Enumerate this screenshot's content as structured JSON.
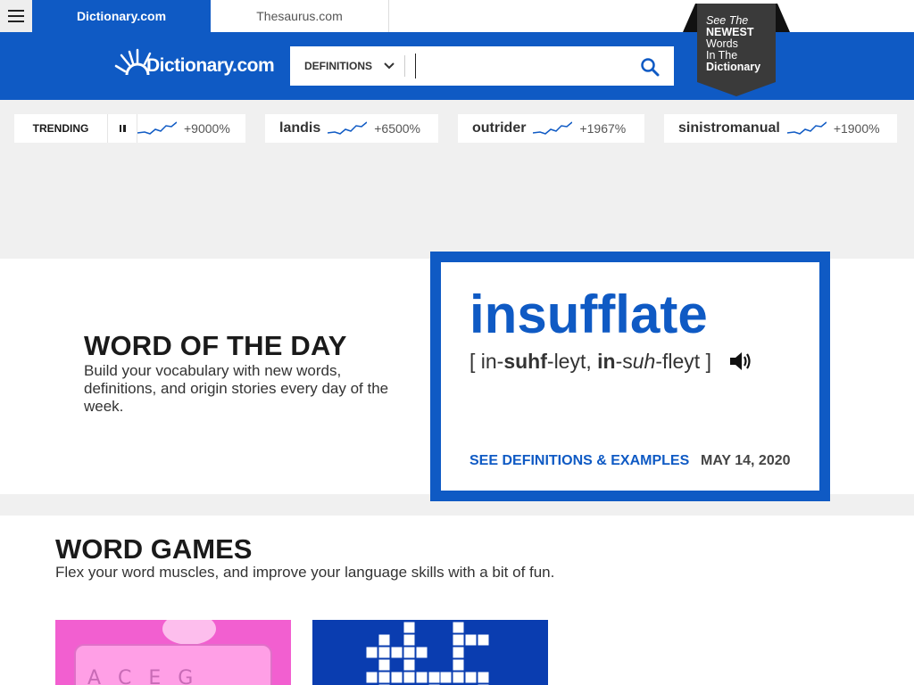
{
  "topbar": {
    "tab_dictionary": "Dictionary.com",
    "tab_thesaurus": "Thesaurus.com"
  },
  "header": {
    "logo_text": "Dictionary.com",
    "search": {
      "selector_label": "DEFINITIONS",
      "value": "",
      "placeholder": ""
    },
    "ribbon": {
      "line1": "See The",
      "line2": "NEWEST",
      "line3": "Words",
      "line4": "In The",
      "line5": "Dictionary"
    }
  },
  "trending": {
    "label": "TRENDING",
    "items": [
      {
        "word": "",
        "change": "+9000%"
      },
      {
        "word": "landis",
        "change": "+6500%"
      },
      {
        "word": "outrider",
        "change": "+1967%"
      },
      {
        "word": "sinistromanual",
        "change": "+1900%"
      }
    ]
  },
  "word_of_the_day": {
    "title": "WORD OF THE DAY",
    "description": "Build your vocabulary with new words, definitions, and origin stories every day of the week.",
    "word": "insufflate",
    "pronunciation": {
      "open": "[ in-",
      "s1": "suhf",
      "s2": "-leyt, ",
      "s3": "in",
      "s4": "-s",
      "s5": "uh",
      "s6": "-fleyt ]"
    },
    "link_label": "SEE DEFINITIONS & EXAMPLES",
    "date": "MAY 14, 2020"
  },
  "word_games": {
    "title": "WORD GAMES",
    "description": "Flex your word muscles, and improve your language skills with a bit of fun.",
    "card1_letters": "A C E G"
  },
  "colors": {
    "brand_blue": "#0f5ac4",
    "ribbon_dark": "#3a3a3a",
    "game1_pink": "#f25fd0",
    "game2_blue": "#0a3db0"
  }
}
